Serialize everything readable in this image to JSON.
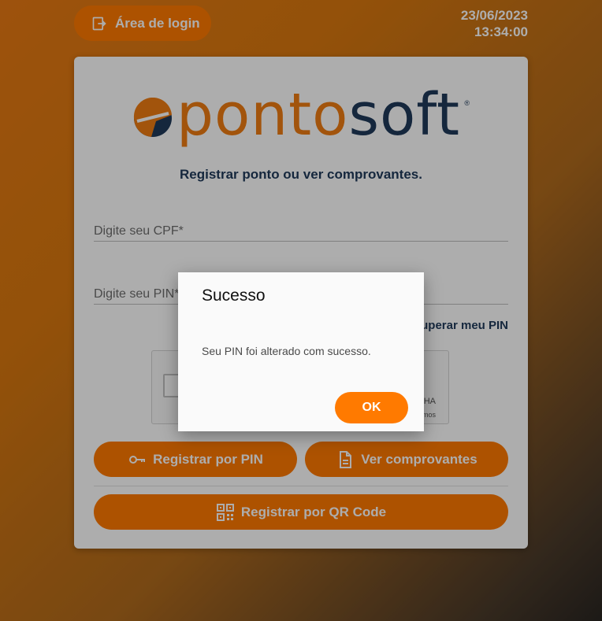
{
  "header": {
    "login_area_label": "Área de login",
    "date": "23/06/2023",
    "time": "13:34:00"
  },
  "logo": {
    "word_part1": "ponto",
    "word_part2": "soft",
    "registered": "®"
  },
  "form": {
    "subtitle": "Registrar ponto ou ver comprovantes.",
    "cpf_placeholder": "Digite seu CPF*",
    "pin_placeholder": "Digite seu PIN*",
    "recover_pin_label": "Recuperar meu PIN"
  },
  "captcha": {
    "brand": "reCAPTCHA",
    "terms": "Privacidade - Termos"
  },
  "actions": {
    "register_pin_label": "Registrar por PIN",
    "receipts_label": "Ver comprovantes",
    "register_qr_label": "Registrar por QR Code"
  },
  "dialog": {
    "title": "Sucesso",
    "message": "Seu PIN foi alterado com sucesso.",
    "ok_label": "OK"
  },
  "colors": {
    "accent": "#ff7a00",
    "brand_navy": "#1f3a5b",
    "brand_orange": "#ef7d12"
  }
}
